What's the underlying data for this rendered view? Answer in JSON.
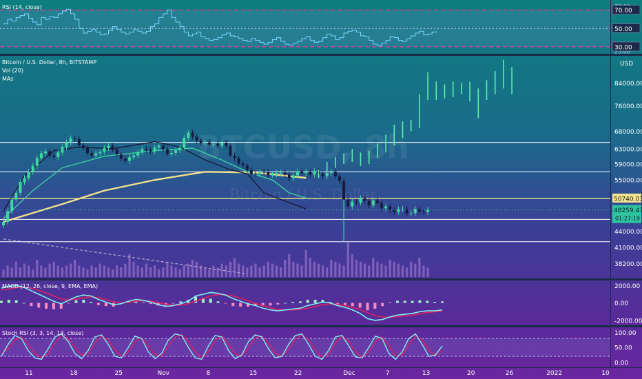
{
  "chart_data": [
    {
      "type": "line",
      "pane": "rsi",
      "title": "RSI (14, close)",
      "y_ticks": [
        "70.00",
        "50.00",
        "30.00"
      ],
      "y_tick_values": [
        70,
        50,
        30
      ],
      "y_partial_ticks": [
        "75.00",
        "25.00"
      ],
      "ylim": [
        24,
        78
      ],
      "overbought": 70,
      "oversold": 30,
      "series": [
        {
          "values": [
            55,
            60,
            58,
            62,
            64,
            66,
            61,
            57,
            54,
            62,
            60,
            63,
            62,
            66,
            69,
            71,
            66,
            60,
            50,
            45,
            47,
            49,
            46,
            43,
            44,
            48,
            52,
            49,
            46,
            44,
            46,
            49,
            47,
            45,
            47,
            52,
            55,
            62,
            66,
            70,
            62,
            57,
            52,
            46,
            42,
            44,
            46,
            41,
            39,
            37,
            38,
            40,
            43,
            45,
            42,
            41,
            39,
            37,
            36,
            39,
            37,
            35,
            33,
            35,
            38,
            40,
            36,
            33,
            32,
            34,
            36,
            39,
            41,
            37,
            35,
            36,
            40,
            44,
            42,
            38,
            40,
            45,
            47,
            48,
            46,
            42,
            41,
            37,
            33,
            31,
            34,
            37,
            41,
            40,
            37,
            36,
            39,
            42,
            45,
            47,
            43,
            44,
            46,
            47
          ]
        }
      ]
    },
    {
      "type": "candlestick",
      "pane": "price",
      "title": "Bitcoin / U.S. Dollar, 8h, BITSTAMP",
      "legend": [
        "Vol (20)",
        "MAs"
      ],
      "watermark_symbol": "BTCUSD, 8h",
      "watermark_name": "Bitcoin / U.S. Dollar",
      "unit": "USD",
      "y_scale": "log",
      "ylim": [
        36000,
        94000
      ],
      "y_ticks": [
        "84000.00",
        "76000.00",
        "68000.00",
        "63000.00",
        "59000.00",
        "55000.00",
        "44000.00",
        "41000.00",
        "38200.00"
      ],
      "y_tick_values": [
        84000,
        76000,
        68000,
        63000,
        59000,
        55000,
        44000,
        41000,
        38200
      ],
      "last_price": "48259.47",
      "countdown": "01:27:19",
      "level_label": "50740.03",
      "horizontal_levels": [
        64800,
        57000,
        50740.03,
        46300,
        42000
      ],
      "x_ticks": [
        "11",
        "18",
        "25",
        "Nov",
        "8",
        "15",
        "22",
        "Dec",
        "7",
        "13",
        "20",
        "26",
        "2022",
        "10"
      ],
      "x_tick_days": [
        11,
        18,
        25,
        32,
        39,
        46,
        53,
        61,
        67,
        73,
        80,
        86,
        93,
        101
      ],
      "projection": {
        "bars": [
          [
            75,
            55500,
            57500
          ],
          [
            77,
            57000,
            59500
          ],
          [
            79,
            58000,
            60800
          ],
          [
            81,
            59000,
            61800
          ],
          [
            83,
            59500,
            63000
          ],
          [
            85,
            58500,
            62000
          ],
          [
            87,
            59000,
            62500
          ],
          [
            89,
            60500,
            64500
          ],
          [
            91,
            62000,
            67000
          ],
          [
            93,
            64000,
            70000
          ],
          [
            95,
            66000,
            71000
          ],
          [
            97,
            68000,
            71500
          ],
          [
            99,
            69000,
            80000
          ],
          [
            101,
            78000,
            88000
          ],
          [
            103,
            78000,
            84500
          ],
          [
            105,
            78500,
            83500
          ],
          [
            107,
            79000,
            84500
          ],
          [
            109,
            80000,
            84000
          ],
          [
            111,
            77500,
            84500
          ],
          [
            113,
            72000,
            82000
          ],
          [
            115,
            78000,
            85000
          ],
          [
            117,
            80000,
            88500
          ],
          [
            119,
            82000,
            93000
          ],
          [
            121,
            80000,
            90000
          ]
        ]
      },
      "moving_averages": [
        {
          "color": "#f4e28c",
          "values": [
            [
              0,
              45800
            ],
            [
              14,
              49500
            ],
            [
              24,
              52500
            ],
            [
              36,
              55000
            ],
            [
              48,
              57000
            ],
            [
              60,
              56800
            ],
            [
              72,
              55500
            ]
          ]
        },
        {
          "color": "#3fd0a0",
          "values": [
            [
              0,
              46500
            ],
            [
              7,
              52500
            ],
            [
              14,
              58000
            ],
            [
              24,
              61000
            ],
            [
              36,
              62500
            ],
            [
              45,
              63200
            ],
            [
              52,
              60000
            ],
            [
              58,
              57000
            ],
            [
              64,
              55000
            ],
            [
              68,
              52000
            ],
            [
              72,
              50800
            ]
          ]
        },
        {
          "color": "#1a1a3a",
          "values": [
            [
              0,
              48000
            ],
            [
              5,
              56000
            ],
            [
              12,
              62500
            ],
            [
              18,
              63500
            ],
            [
              26,
              63000
            ],
            [
              36,
              65000
            ],
            [
              42,
              63500
            ],
            [
              48,
              60000
            ],
            [
              54,
              57500
            ],
            [
              58,
              56500
            ],
            [
              62,
              52000
            ],
            [
              66,
              50500
            ],
            [
              72,
              48500
            ]
          ]
        }
      ],
      "trend_line": [
        [
          0,
          42500
        ],
        [
          58,
          36500
        ]
      ],
      "series": [
        {
          "name": "price",
          "values": [
            45800,
            48000,
            50500,
            52000,
            54500,
            55500,
            57000,
            58500,
            60500,
            61800,
            62300,
            61200,
            60800,
            62000,
            63500,
            64800,
            66000,
            65800,
            64000,
            63200,
            61800,
            61200,
            61800,
            62200,
            63200,
            63800,
            62800,
            61500,
            60300,
            59800,
            60700,
            61200,
            62100,
            63000,
            62700,
            62300,
            63400,
            63900,
            62900,
            61600,
            61900,
            62600,
            63300,
            66100,
            67600,
            66400,
            65300,
            64600,
            64800,
            64200,
            64400,
            63900,
            64700,
            63800,
            61200,
            60500,
            59100,
            58600,
            57400,
            56500,
            56400,
            57000,
            56900,
            56200,
            56300,
            56700,
            56800,
            56300,
            55400,
            56100,
            57100,
            56700,
            57000,
            56300,
            57200,
            56400,
            55900,
            56700,
            57000,
            55900,
            54700,
            50500,
            49000,
            50000,
            49800,
            50800,
            50200,
            49200,
            50300,
            49700,
            48600,
            49000,
            48200,
            47800,
            48400,
            48500,
            47500,
            47600,
            48500,
            47900,
            47800,
            48300
          ]
        }
      ],
      "volume": {
        "values": [
          4,
          6,
          5,
          8,
          5,
          7,
          6,
          4,
          9,
          6,
          5,
          7,
          8,
          6,
          5,
          6,
          7,
          9,
          6,
          5,
          4,
          6,
          5,
          7,
          6,
          5,
          4,
          6,
          5,
          7,
          12,
          8,
          6,
          5,
          7,
          5,
          6,
          4,
          5,
          8,
          6,
          5,
          4,
          6,
          7,
          9,
          8,
          6,
          5,
          4,
          6,
          5,
          7,
          6,
          8,
          10,
          7,
          6,
          5,
          6,
          7,
          5,
          6,
          8,
          7,
          6,
          5,
          9,
          12,
          8,
          7,
          6,
          14,
          10,
          8,
          7,
          6,
          5,
          9,
          8,
          7,
          6,
          18,
          12,
          9,
          8,
          7,
          6,
          10,
          8,
          7,
          6,
          9,
          8,
          7,
          6,
          5,
          8,
          7,
          10,
          6,
          5
        ]
      }
    },
    {
      "type": "line",
      "pane": "macd",
      "title": "MACD (12, 26, close, 9, EMA, EMA)",
      "y_ticks": [
        "2000.00",
        "0.00",
        "-2000.00"
      ],
      "y_tick_values": [
        2000,
        0,
        -2000
      ],
      "ylim": [
        -2400,
        2500
      ],
      "series": [
        {
          "name": "MACD",
          "values": [
            1700,
            1900,
            2000,
            1800,
            1400,
            1000,
            600,
            200,
            -100,
            300,
            700,
            900,
            800,
            400,
            100,
            -200,
            -100,
            200,
            400,
            300,
            100,
            -200,
            -400,
            -300,
            -100,
            200,
            800,
            1000,
            1200,
            1100,
            900,
            500,
            200,
            -100,
            -300,
            -600,
            -800,
            -900,
            -800,
            -700,
            -600,
            -300,
            -100,
            100,
            0,
            -300,
            -500,
            -800,
            -1200,
            -1800,
            -2000,
            -1900,
            -1600,
            -1400,
            -1300,
            -1200,
            -1000,
            -900,
            -900,
            -800
          ]
        },
        {
          "name": "Signal",
          "values": [
            1500,
            1600,
            1750,
            1800,
            1700,
            1450,
            1150,
            800,
            450,
            350,
            450,
            600,
            700,
            600,
            400,
            150,
            0,
            50,
            200,
            250,
            200,
            50,
            -150,
            -250,
            -250,
            -100,
            200,
            500,
            800,
            950,
            950,
            800,
            550,
            250,
            -50,
            -300,
            -550,
            -750,
            -800,
            -800,
            -750,
            -600,
            -400,
            -200,
            -100,
            -150,
            -300,
            -500,
            -750,
            -1100,
            -1450,
            -1600,
            -1650,
            -1600,
            -1500,
            -1400,
            -1250,
            -1100,
            -1000,
            -950
          ]
        }
      ]
    },
    {
      "type": "line",
      "pane": "stoch",
      "title": "Stoch RSI (3, 3, 14, 14, close)",
      "y_ticks": [
        "100.00",
        "50.00",
        "0.00"
      ],
      "y_tick_values": [
        100,
        50,
        0
      ],
      "ylim": [
        -12,
        115
      ],
      "upper": 80,
      "lower": 20,
      "series": [
        {
          "name": "K",
          "values": [
            20,
            60,
            90,
            80,
            40,
            15,
            10,
            45,
            85,
            95,
            70,
            30,
            12,
            40,
            85,
            92,
            60,
            20,
            15,
            50,
            88,
            80,
            35,
            12,
            30,
            75,
            95,
            90,
            50,
            15,
            10,
            55,
            90,
            85,
            40,
            12,
            25,
            70,
            92,
            85,
            45,
            15,
            20,
            60,
            90,
            95,
            60,
            20,
            10,
            40,
            85,
            90,
            55,
            18,
            15,
            50,
            88,
            80,
            30,
            10,
            35,
            80,
            95,
            60,
            20,
            25,
            55
          ]
        },
        {
          "name": "D",
          "values": [
            30,
            45,
            75,
            85,
            60,
            30,
            15,
            30,
            65,
            90,
            80,
            50,
            25,
            30,
            65,
            88,
            75,
            40,
            20,
            35,
            70,
            82,
            55,
            25,
            22,
            55,
            85,
            92,
            70,
            35,
            15,
            35,
            75,
            88,
            60,
            28,
            22,
            50,
            82,
            88,
            62,
            30,
            20,
            45,
            78,
            92,
            75,
            40,
            18,
            28,
            65,
            88,
            70,
            35,
            18,
            35,
            70,
            85,
            55,
            22,
            25,
            60,
            88,
            75,
            40,
            22,
            40
          ]
        }
      ]
    }
  ]
}
